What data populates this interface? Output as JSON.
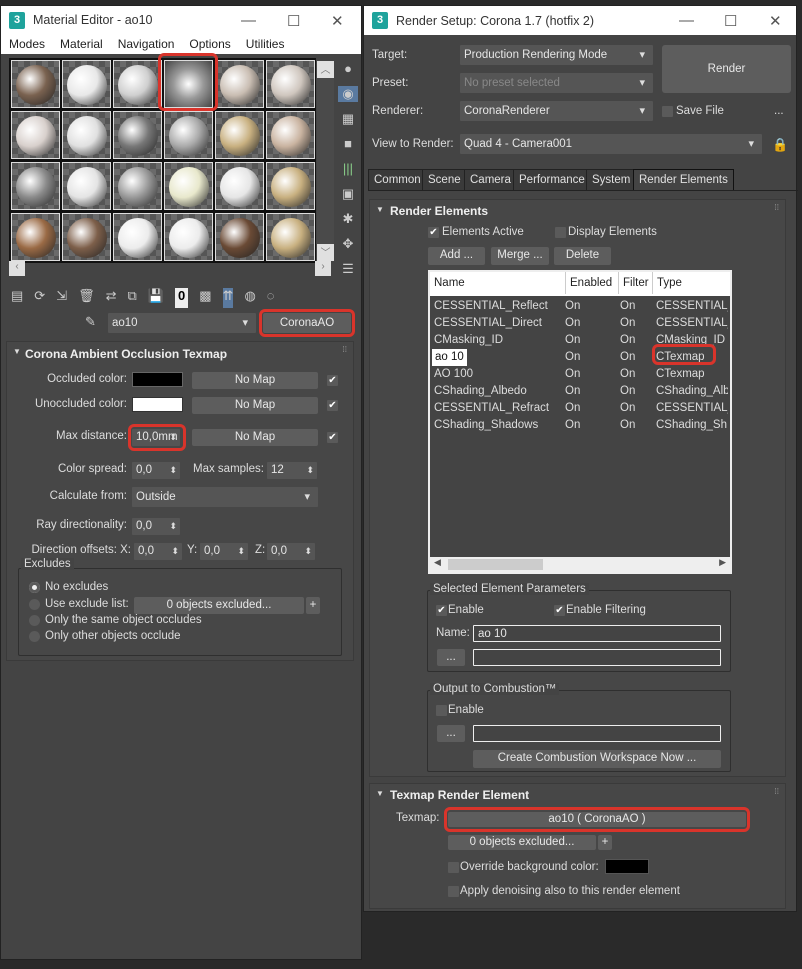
{
  "material_editor": {
    "title": "Material Editor - ao10",
    "menu": [
      "Modes",
      "Material",
      "Navigation",
      "Options",
      "Utilities"
    ],
    "slots": [
      "#7a6250",
      "#e8e8e8",
      "#cfcfcf",
      "AO",
      "#c9bdb2",
      "#cfc6be",
      "#d8d0cc",
      "#e0e0e0",
      "#777",
      "#aaa",
      "#c8b080",
      "#c9b3a0",
      "#8a8a8a",
      "#e4e4e4",
      "#999",
      "#e8e8cc",
      "#e6e6e6",
      "#c8b080",
      "#9a6a45",
      "#7d5f4a",
      "#ececec",
      "#ececec",
      "#6a4a35",
      "#c8b080"
    ],
    "material_name": "ao10",
    "type_button": "CoronaAO",
    "rollout": {
      "title": "Corona Ambient Occlusion Texmap",
      "occluded_label": "Occluded color:",
      "unoccluded_label": "Unoccluded color:",
      "occluded_color": "#000000",
      "unoccluded_color": "#ffffff",
      "no_map": "No Map",
      "max_distance_label": "Max distance:",
      "max_distance": "10,0mm",
      "color_spread_label": "Color spread:",
      "color_spread": "0,0",
      "max_samples_label": "Max samples:",
      "max_samples": "12",
      "calculate_from_label": "Calculate from:",
      "calculate_from": "Outside",
      "ray_dir_label": "Ray directionality:",
      "ray_dir": "0,0",
      "dir_offsets_label": "Direction offsets: X:",
      "x": "0,0",
      "y_label": "Y:",
      "y": "0,0",
      "z_label": "Z:",
      "z": "0,0",
      "excludes_title": "Excludes",
      "no_excludes": "No excludes",
      "use_exclude_list": "Use exclude list:",
      "objects_excluded": "0 objects excluded...",
      "plus": "+",
      "same_object": "Only the same object occludes",
      "other_objects": "Only other objects occlude"
    }
  },
  "render_setup": {
    "title": "Render Setup: Corona 1.7 (hotfix 2)",
    "target_label": "Target:",
    "target": "Production Rendering Mode",
    "preset_label": "Preset:",
    "preset": "No preset selected",
    "renderer_label": "Renderer:",
    "renderer": "CoronaRenderer",
    "save_file": "Save File",
    "more": "...",
    "view_label": "View to Render:",
    "view": "Quad 4 - Camera001",
    "render_button": "Render",
    "tabs": [
      "Common",
      "Scene",
      "Camera",
      "Performance",
      "System",
      "Render Elements"
    ],
    "elements": {
      "title": "Render Elements",
      "elements_active": "Elements Active",
      "display_elements": "Display Elements",
      "add": "Add ...",
      "merge": "Merge ...",
      "delete": "Delete",
      "columns": [
        "Name",
        "Enabled",
        "Filter",
        "Type"
      ],
      "rows": [
        [
          "CESSENTIAL_Reflect",
          "On",
          "On",
          "CESSENTIAL_..."
        ],
        [
          "CESSENTIAL_Direct",
          "On",
          "On",
          "CESSENTIAL_..."
        ],
        [
          "CMasking_ID",
          "On",
          "On",
          "CMasking_ID"
        ],
        [
          "ao 10",
          "On",
          "On",
          "CTexmap"
        ],
        [
          "AO 100",
          "On",
          "On",
          "CTexmap"
        ],
        [
          "CShading_Albedo",
          "On",
          "On",
          "CShading_Alb..."
        ],
        [
          "CESSENTIAL_Refract",
          "On",
          "On",
          "CESSENTIAL_..."
        ],
        [
          "CShading_Shadows",
          "On",
          "On",
          "CShading_Sh..."
        ]
      ]
    },
    "selected_params": {
      "title": "Selected Element Parameters",
      "enable": "Enable",
      "enable_filtering": "Enable Filtering",
      "name_label": "Name:",
      "name": "ao 10",
      "browse": "..."
    },
    "combustion": {
      "title": "Output to Combustion™",
      "enable": "Enable",
      "browse": "...",
      "create": "Create Combustion Workspace Now ..."
    },
    "texmap_element": {
      "title": "Texmap Render Element",
      "texmap_label": "Texmap:",
      "texmap": "ao10  ( CoronaAO )",
      "objects_excluded": "0 objects excluded...",
      "plus": "+",
      "override_bg": "Override background color:",
      "override_color": "#000000",
      "denoise": "Apply denoising also to this render element"
    }
  }
}
